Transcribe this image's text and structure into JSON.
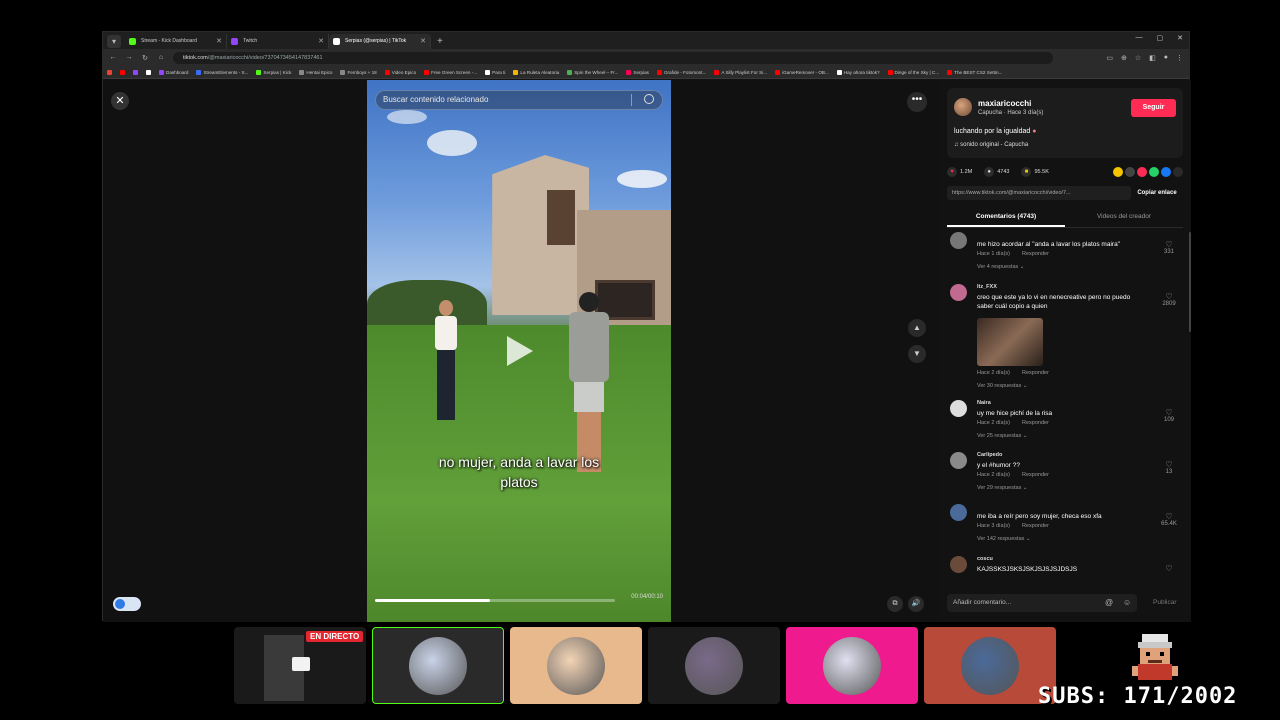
{
  "browser": {
    "tabs": [
      {
        "title": "Stream - Kick Dashboard",
        "fav_color": "#53fc18",
        "active": false
      },
      {
        "title": "Twitch",
        "fav_color": "#9146ff",
        "active": false
      },
      {
        "title": "Serpias (@serpias) | TikTok",
        "fav_color": "#ffffff",
        "active": true
      }
    ],
    "url_host": "tiktok.com",
    "url_path": "/@maxiaricocchi/video/7370473454147837461",
    "bookmarks": [
      {
        "label": "",
        "color": "#ea4335"
      },
      {
        "label": "",
        "color": "#ff0000"
      },
      {
        "label": "",
        "color": "#9146ff"
      },
      {
        "label": "",
        "color": "#ffffff"
      },
      {
        "label": "Dashboard",
        "color": "#9146ff"
      },
      {
        "label": "StreamElements - S...",
        "color": "#3b6ef6"
      },
      {
        "label": "Serpias | Kick",
        "color": "#53fc18"
      },
      {
        "label": "Hentai Epico",
        "color": "#888888"
      },
      {
        "label": "Femboys + 18",
        "color": "#888888"
      },
      {
        "label": "Video Epico",
        "color": "#ff0000"
      },
      {
        "label": "Free Green Screen -...",
        "color": "#ff0000"
      },
      {
        "label": "Para ti",
        "color": "#ffffff"
      },
      {
        "label": "La Ruleta Aleatoria",
        "color": "#f5b400"
      },
      {
        "label": "Spin the Wheel – Fr...",
        "color": "#4caf50"
      },
      {
        "label": "Serpias",
        "color": "#ff0050"
      },
      {
        "label": "Grafide - Fotomont...",
        "color": "#ff0000"
      },
      {
        "label": "A Silly Playlist For Si...",
        "color": "#ff0000"
      },
      {
        "label": "iGameRemover - OB...",
        "color": "#ff0000"
      },
      {
        "label": "Hay ahora tiktok?",
        "color": "#ffffff"
      },
      {
        "label": "Dinge of the Sky | C...",
        "color": "#ff0000"
      },
      {
        "label": "The BEST CS2 Settin...",
        "color": "#ff0000"
      }
    ]
  },
  "video": {
    "search_placeholder": "Buscar contenido relacionado",
    "subtitle_line1": "no mujer, anda a lavar los",
    "subtitle_line2": "platos",
    "progress": 0.48,
    "time": "00:04/00:10"
  },
  "creator": {
    "username": "maxiaricocchi",
    "meta": "Capucha · Hace 3 día(s)",
    "follow_label": "Seguir",
    "description": "luchando por la igualdad",
    "sound": "sonido original - Capucha"
  },
  "stats": {
    "likes": "1.2M",
    "comments": "4743",
    "saves": "95.5K"
  },
  "share_colors": [
    "#f5c400",
    "#444444",
    "#fe2c55",
    "#25d366",
    "#1877f2",
    "#2a2a2a"
  ],
  "link": {
    "url": "https://www.tiktok.com/@maxiaricocchi/video/7...",
    "copy_label": "Copiar enlace"
  },
  "tabs": {
    "comments_label": "Comentarios (4743)",
    "creator_videos_label": "Videos del creador"
  },
  "comments": [
    {
      "user": "",
      "text": "me hizo acordar al \"anda a lavar los platos maira\"",
      "time": "Hace 1 día(s)",
      "reply": "Responder",
      "replies": "Ver 4 respuestas",
      "likes": "331",
      "avatar": "#777777"
    },
    {
      "user": "ltz_FXX",
      "text": "creo que este ya lo vi en nenecreative pero no puedo saber cuál copio a quien",
      "time": "Hace 2 día(s)",
      "reply": "Responder",
      "replies": "Ver 30 respuestas",
      "likes": "2809",
      "avatar": "#c06a90"
    },
    {
      "user": "Naira",
      "text": "uy me hice pichí de la risa",
      "time": "Hace 2 día(s)",
      "reply": "Responder",
      "replies": "Ver 25 respuestas",
      "likes": "109",
      "avatar": "#dddddd"
    },
    {
      "user": "Carlipedo",
      "text": "y el #humor ??",
      "time": "Hace 2 día(s)",
      "reply": "Responder",
      "replies": "Ver 29 respuestas",
      "likes": "13",
      "avatar": "#8a8a8a"
    },
    {
      "user": "",
      "text": "me iba a reír pero soy mujer, checa eso xfa",
      "time": "Hace 3 día(s)",
      "reply": "Responder",
      "replies": "Ver 142 respuestas",
      "likes": "65.4K",
      "avatar": "#4a6a9a"
    },
    {
      "user": "coscu",
      "text": "KAJSSKSJSKSJSKJSJSJSJDSJS",
      "time": "",
      "reply": "",
      "replies": "",
      "likes": "",
      "avatar": "#6a4a3a"
    }
  ],
  "comment_input": {
    "placeholder": "Añadir comentario...",
    "publish_label": "Publicar"
  },
  "overlay": {
    "live_label": "EN DIRECTO",
    "subs": "SUBS: 171/2002",
    "cams": [
      {
        "bg": "#1a1a1a",
        "pic": "#1a1a1a"
      },
      {
        "bg": "#2a2a2a",
        "pic": "#c9d3e8"
      },
      {
        "bg": "#e9b98e",
        "pic": "#f3d4b6"
      },
      {
        "bg": "#1a1a1a",
        "pic": "#7a6a8a"
      },
      {
        "bg": "#ee1a8e",
        "pic": "#e0e0f0"
      },
      {
        "bg": "#b84a3a",
        "pic": "#4a6a9a"
      }
    ]
  }
}
